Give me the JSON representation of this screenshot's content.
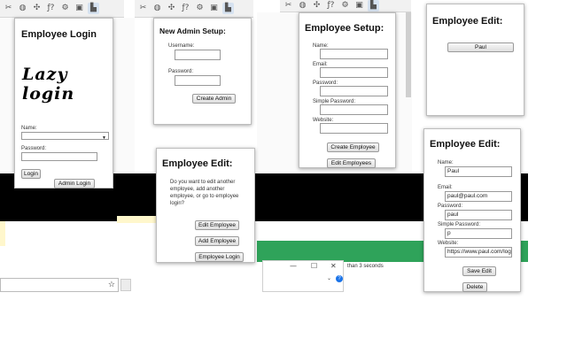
{
  "toolbar_icons": [
    "crop-icon",
    "circle-icon",
    "puzzle-icon",
    "formula-icon",
    "gear-icon",
    "screen-icon",
    "extension-icon"
  ],
  "toolbar_glyphs": {
    "crop": "✂",
    "circle": "◍",
    "puzzle": "✣",
    "formula": "ƒ?",
    "gear": "⚙",
    "screen": "▣",
    "extension": "▙"
  },
  "login": {
    "title": "Employee Login",
    "logo_line1": "Lazy",
    "logo_line2": "login",
    "name_label": "Name:",
    "password_label": "Password:",
    "login_button": "Login",
    "admin_login_button": "Admin Login"
  },
  "admin_setup": {
    "title": "New Admin Setup:",
    "username_label": "Username:",
    "password_label": "Password:",
    "create_button": "Create Admin"
  },
  "employee_edit_prompt": {
    "title": "Employee Edit:",
    "text_line1": "Do you want to edit another",
    "text_line2": "employee, add another",
    "text_line3": "employee, or go to employee",
    "text_line4": "login?",
    "edit_button": "Edit Employee",
    "add_button": "Add Employee",
    "login_button": "Employee Login"
  },
  "employee_setup": {
    "title": "Employee Setup:",
    "name_label": "Name:",
    "email_label": "Email:",
    "password_label": "Password:",
    "simple_password_label": "Simple Password:",
    "website_label": "Website:",
    "create_button": "Create Employee",
    "edit_button": "Edit Employees"
  },
  "employee_list": {
    "title": "Employee Edit:",
    "employee_button": "Paul"
  },
  "employee_form": {
    "title": "Employee Edit:",
    "name_label": "Name:",
    "name_value": "Paul",
    "email_label": "Email:",
    "email_value": "paul@paul.com",
    "password_label": "Password:",
    "password_value": "paul",
    "simple_password_label": "Simple Password:",
    "simple_password_value": "p",
    "website_label": "Website:",
    "website_value": "https://www.paul.com/login",
    "save_button": "Save Edit",
    "delete_button": "Delete"
  },
  "background": {
    "snippet_text": "than 3 seconds",
    "window_minimize": "—",
    "window_maximize": "☐",
    "window_close": "✕",
    "star": "☆"
  }
}
